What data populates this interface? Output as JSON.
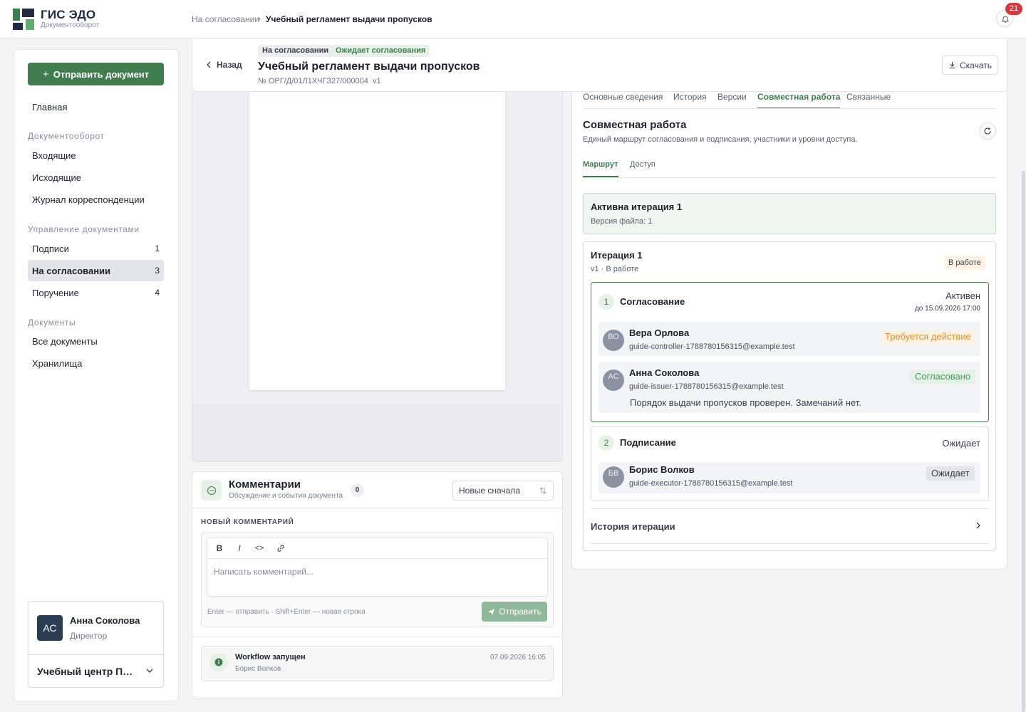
{
  "brand": {
    "name": "ГИС ЭДО",
    "subtitle": "Документооборот"
  },
  "breadcrumb": {
    "parent": "На согласовании",
    "separator": "›",
    "current": "Учебный регламент выдачи пропусков"
  },
  "notifications": {
    "count": "21",
    "icon": "bell-icon"
  },
  "sidebar": {
    "send_button": "Отправить документ",
    "home": "Главная",
    "sections": [
      {
        "title": "Документооборот"
      },
      {
        "title": "Управление документами"
      },
      {
        "title": "Документы"
      }
    ],
    "items": [
      {
        "label": "Входящие",
        "count": ""
      },
      {
        "label": "Исходящие",
        "count": ""
      },
      {
        "label": "Журнал корреспонденции",
        "count": ""
      },
      {
        "label": "Подписи",
        "count": "1"
      },
      {
        "label": "На согласовании",
        "count": "3"
      },
      {
        "label": "Поручение",
        "count": "4"
      },
      {
        "label": "Все документы",
        "count": ""
      },
      {
        "label": "Хранилища",
        "count": ""
      }
    ],
    "user": {
      "initials": "АС",
      "name": "Анна Соколова",
      "role": "Директор",
      "org": "Учебный центр Пропусков"
    }
  },
  "doc": {
    "back": "Назад",
    "badge_status": "На согласовании",
    "badge_wait": "Ожидает согласования",
    "title": "Учебный регламент выдачи пропусков",
    "number": "№ ОРГ/Д/01Л1ХЧГЗ27/000004  v1",
    "download": "Скачать"
  },
  "comments": {
    "title": "Комментарии",
    "subtitle": "Обсуждение и события документа",
    "count": "0",
    "sort": "Новые сначала",
    "new_label": "НОВЫЙ КОММЕНТАРИЙ",
    "toolbar": {
      "bold": "B",
      "italic": "I",
      "code": "<>"
    },
    "placeholder": "Написать комментарий...",
    "hint": "Enter — отправить · Shift+Enter — новая строка",
    "submit": "Отправить",
    "event": {
      "title": "Workflow запущен",
      "author": "Борис Волков",
      "time": "07.09.2026 16:05"
    }
  },
  "tabs": [
    "Основные сведения",
    "История",
    "Версии",
    "Совместная работа",
    "Связанные"
  ],
  "collab": {
    "title": "Совместная работа",
    "desc": "Единый маршрут согласования и подписания, участники и уровни доступа.",
    "subtabs": [
      "Маршрут",
      "Доступ"
    ],
    "active_iter": {
      "title": "Активна итерация 1",
      "version": "Версия файла: 1"
    },
    "iteration": {
      "title": "Итерация 1",
      "sub": "v1 · В работе",
      "status": "В работе",
      "stages": [
        {
          "num": "1",
          "name": "Согласование",
          "state": "Активен",
          "deadline": "до 15.09.2026 17:00"
        },
        {
          "num": "2",
          "name": "Подписание",
          "state": "Ожидает"
        }
      ],
      "participants": [
        {
          "initials": "ВО",
          "name": "Вера Орлова",
          "email": "guide-controller-1788780156315@example.test",
          "status": "Требуется действие"
        },
        {
          "initials": "АС",
          "name": "Анна Соколова",
          "email": "guide-issuer-1788780156315@example.test",
          "status": "Согласовано",
          "comment": "Порядок выдачи пропусков проверен. Замечаний нет."
        },
        {
          "initials": "БВ",
          "name": "Борис Волков",
          "email": "guide-executor-1788780156315@example.test",
          "status": "Ожидает"
        }
      ],
      "history": "История итерации"
    }
  },
  "colors": {
    "accent": "#3f7d4f",
    "brand_dark": "#1f2a44",
    "warning": "#e0902a",
    "danger": "#d9363e"
  }
}
